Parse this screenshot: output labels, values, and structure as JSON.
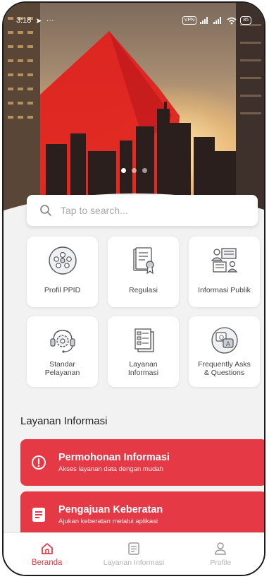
{
  "status_bar": {
    "time": "3:18",
    "extra": "···",
    "vpn": "VPN",
    "battery": "85"
  },
  "hero": {
    "dots": 3,
    "active_dot": 0
  },
  "search": {
    "placeholder": "Tap to search..."
  },
  "menu": [
    {
      "label": "Profil PPID",
      "icon": "people-group-icon"
    },
    {
      "label": "Regulasi",
      "icon": "document-certificate-icon"
    },
    {
      "label": "Informasi Publik",
      "icon": "public-board-icon"
    },
    {
      "label": "Standar\nPelayanan",
      "icon": "support-gear-icon"
    },
    {
      "label": "Layanan\nInformasi",
      "icon": "document-stack-icon"
    },
    {
      "label": "Frequently Asks\n& Questions",
      "icon": "qa-chat-icon"
    }
  ],
  "section": {
    "title": "Layanan Informasi"
  },
  "services": [
    {
      "title": "Permohonan Informasi",
      "subtitle": "Akses layanan data dengan mudah",
      "icon": "alert-circle-icon"
    },
    {
      "title": "Pengajuan Keberatan",
      "subtitle": "Ajukan keberatan melalui aplikasi",
      "icon": "document-list-icon"
    }
  ],
  "nav": [
    {
      "label": "Beranda",
      "icon": "home-icon",
      "active": true
    },
    {
      "label": "Layanan Informasi",
      "icon": "document-icon",
      "active": false
    },
    {
      "label": "Profile",
      "icon": "user-icon",
      "active": false
    }
  ],
  "colors": {
    "accent": "#e63946",
    "background": "#f2f2f2"
  }
}
